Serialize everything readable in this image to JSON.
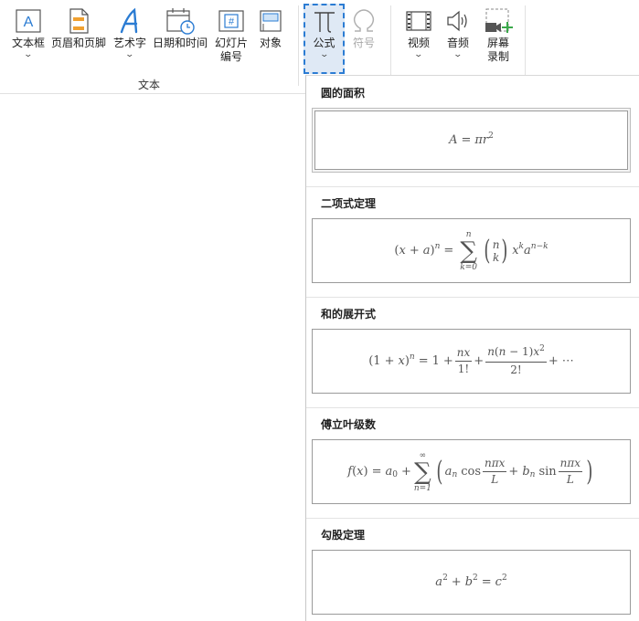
{
  "ribbon": {
    "text_group_label": "文本",
    "buttons": {
      "textbox": "文本框",
      "header_footer": "页眉和页脚",
      "wordart": "艺术字",
      "datetime": "日期和时间",
      "slide_number_line1": "幻灯片",
      "slide_number_line2": "编号",
      "object": "对象",
      "equation": "公式",
      "symbol": "符号",
      "video": "视频",
      "audio": "音频",
      "screen_recording_line1": "屏幕",
      "screen_recording_line2": "录制"
    },
    "icons": {
      "textbox": "textbox-icon",
      "header_footer": "header-footer-icon",
      "wordart": "wordart-icon",
      "datetime": "datetime-icon",
      "slide_number": "slide-number-icon",
      "object": "object-icon",
      "equation": "pi-icon",
      "symbol": "omega-icon",
      "video": "film-icon",
      "audio": "speaker-icon",
      "screen_recording": "screen-record-icon"
    },
    "accent_color": "#2b7cd3",
    "selected_bg": "#dfe9f5"
  },
  "gallery": {
    "sections": [
      {
        "title": "圆的面积",
        "formula": "A = πr²"
      },
      {
        "title": "二项式定理",
        "formula": "(x + a)ⁿ = Σ_{k=0}^{n} (n choose k) xᵏ aⁿ⁻ᵏ"
      },
      {
        "title": "和的展开式",
        "formula": "(1 + x)ⁿ = 1 + nx/1! + n(n − 1)x²/2! + ⋯"
      },
      {
        "title": "傅立叶级数",
        "formula": "f(x) = a₀ + Σ_{n=1}^{∞} (aₙ cos(nπx/L) + bₙ sin(nπx/L))"
      },
      {
        "title": "勾股定理",
        "formula": "a² + b² = c²"
      }
    ]
  }
}
